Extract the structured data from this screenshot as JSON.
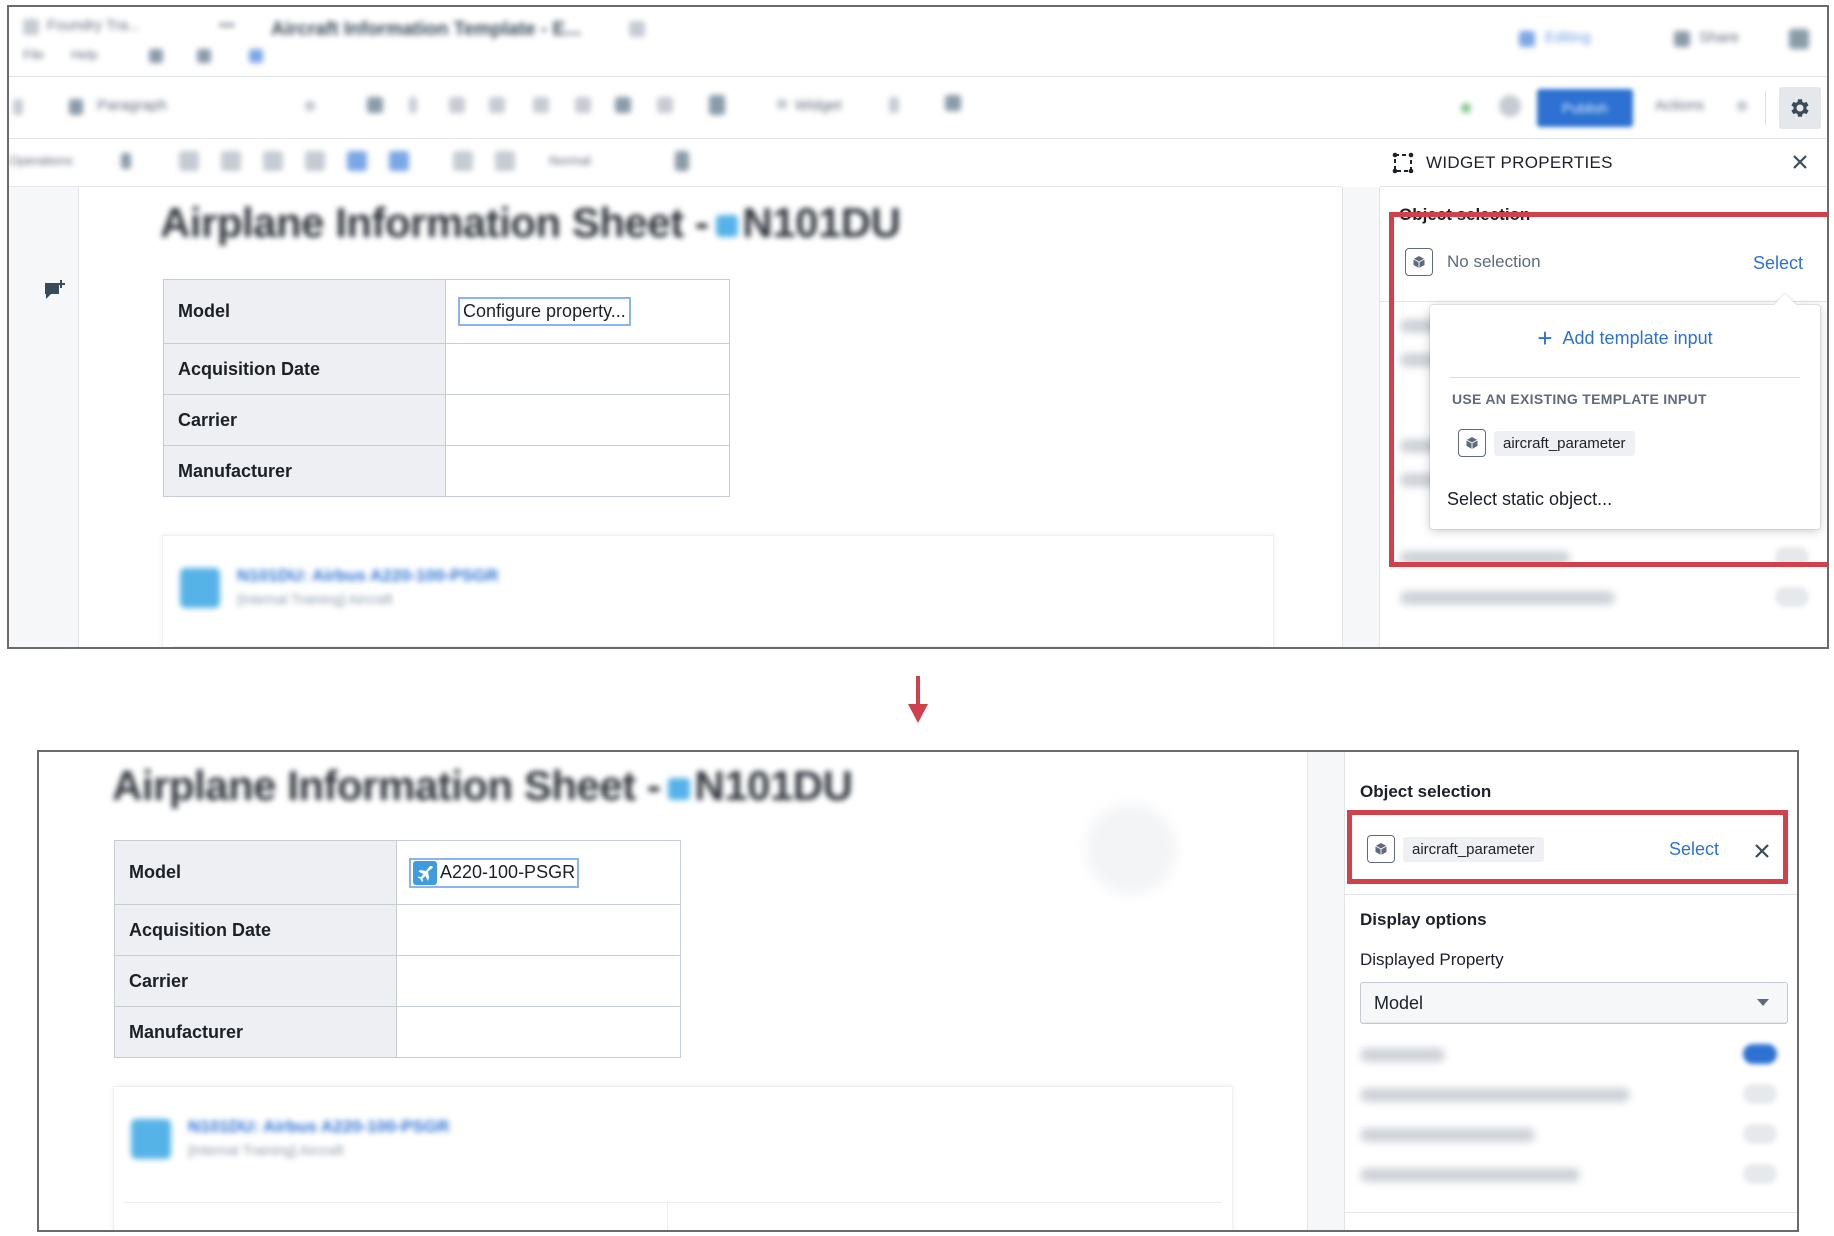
{
  "app": {
    "breadcrumb": [
      "Foundry Tra...",
      "•••"
    ],
    "doc_title": "Aircraft Information Template - E...",
    "menu": [
      "File",
      "Help"
    ],
    "editing_label": "Editing",
    "share_label": "Share",
    "paragraph_style": "Paragraph",
    "insert_widget_label": "Widget",
    "publish_label": "Publish",
    "actions_label": "Actions",
    "operations_label": "Operations",
    "normal_label": "Normal"
  },
  "before": {
    "document": {
      "title": "Airplane Information Sheet -",
      "title_object": "N101DU",
      "table": [
        {
          "label": "Model",
          "value": "Configure property..."
        },
        {
          "label": "Acquisition Date",
          "value": ""
        },
        {
          "label": "Carrier",
          "value": ""
        },
        {
          "label": "Manufacturer",
          "value": ""
        }
      ],
      "card": {
        "title": "N101DU: Airbus A220-100-PSGR",
        "subtitle": "[Internal Training] Aircraft"
      }
    },
    "panel": {
      "header": "WIDGET PROPERTIES",
      "object_selection_label": "Object selection",
      "selection_text": "No selection",
      "select_label": "Select",
      "popover": {
        "add_template_input": "Add template input",
        "existing_heading": "USE AN EXISTING TEMPLATE INPUT",
        "existing_inputs": [
          "aircraft_parameter"
        ],
        "select_static": "Select static object..."
      },
      "blurred_options": [
        "Show property name",
        "Apply ontology formatting"
      ]
    }
  },
  "after": {
    "document": {
      "title": "Airplane Information Sheet -",
      "title_object": "N101DU",
      "table": [
        {
          "label": "Model",
          "value": "A220-100-PSGR"
        },
        {
          "label": "Acquisition Date",
          "value": ""
        },
        {
          "label": "Carrier",
          "value": ""
        },
        {
          "label": "Manufacturer",
          "value": ""
        }
      ],
      "card": {
        "title": "N101DU: Airbus A220-100-PSGR",
        "subtitle": "[Internal Training] Aircraft"
      }
    },
    "panel": {
      "object_selection_label": "Object selection",
      "selected_input": "aircraft_parameter",
      "select_label": "Select",
      "display_options_label": "Display options",
      "displayed_property_label": "Displayed Property",
      "displayed_property_value": "Model",
      "toggles": [
        {
          "label": "Show icon",
          "on": true
        },
        {
          "label": "Show object properties on hover",
          "on": false
        },
        {
          "label": "Show property name",
          "on": false
        },
        {
          "label": "Apply ontology formatting",
          "on": false
        }
      ]
    }
  },
  "colors": {
    "highlight": "#d1414b",
    "accent": "#2d72d2",
    "object_icon": "#56b3e8"
  }
}
